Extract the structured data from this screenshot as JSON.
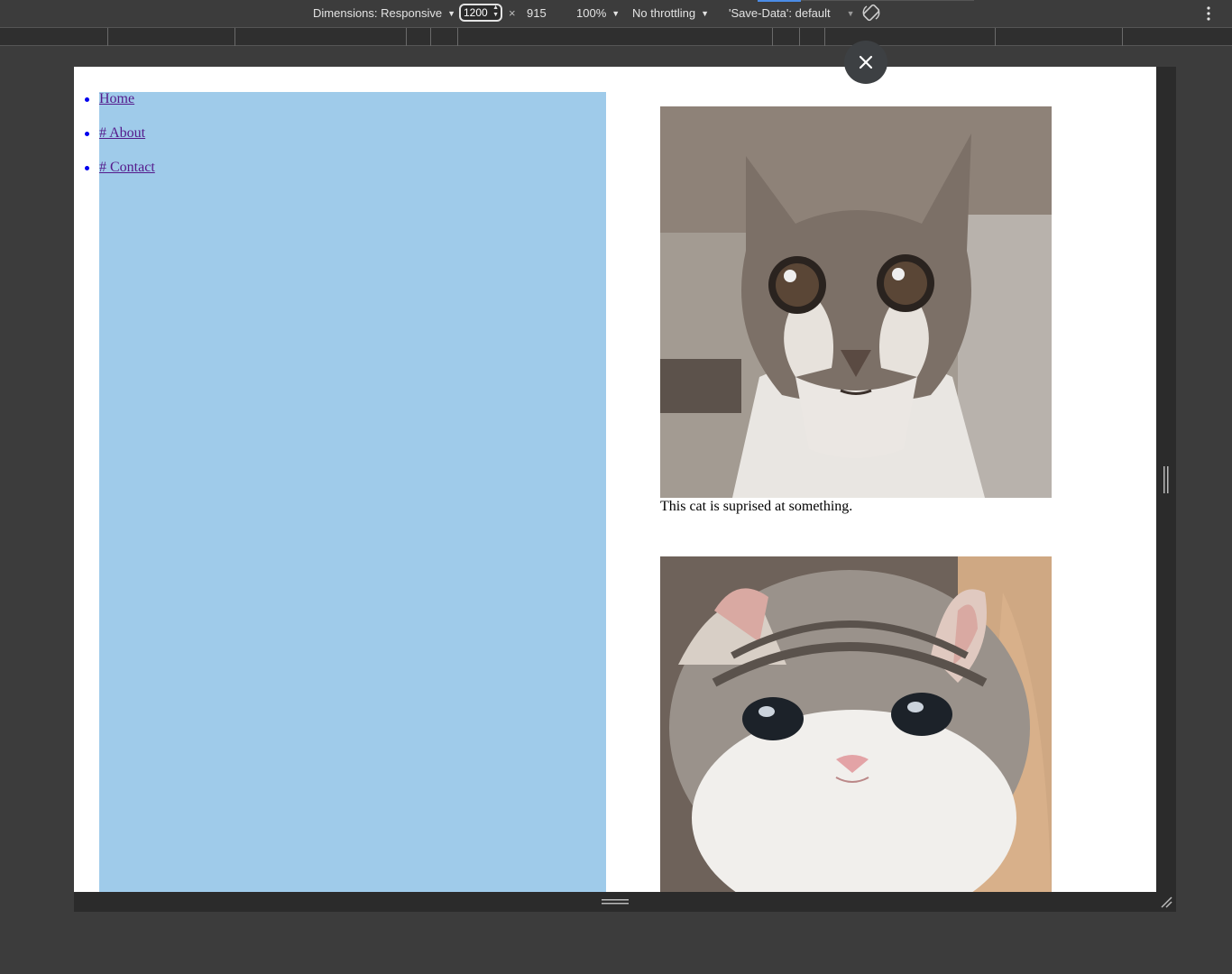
{
  "toolbar": {
    "dimensions_label": "Dimensions: Responsive",
    "width_value": "1200",
    "times": "×",
    "height_value": "915",
    "zoom": "100%",
    "throttling": "No throttling",
    "save_data": "'Save-Data': default",
    "rotate_icon": "rotate-icon",
    "more_icon": "kebab-menu-icon"
  },
  "page": {
    "nav": [
      {
        "label": "Home"
      },
      {
        "label": "# About"
      },
      {
        "label": "# Contact"
      }
    ],
    "figures": [
      {
        "alt": "surprised tabby cat with wide eyes",
        "caption": "This cat is suprised at something."
      },
      {
        "alt": "fluffy tabby kitten with big round eyes",
        "caption": ""
      }
    ],
    "sidebar_color": "#9fcbea",
    "link_color": "#0000ee"
  },
  "overlay": {
    "close_icon": "close-icon"
  }
}
